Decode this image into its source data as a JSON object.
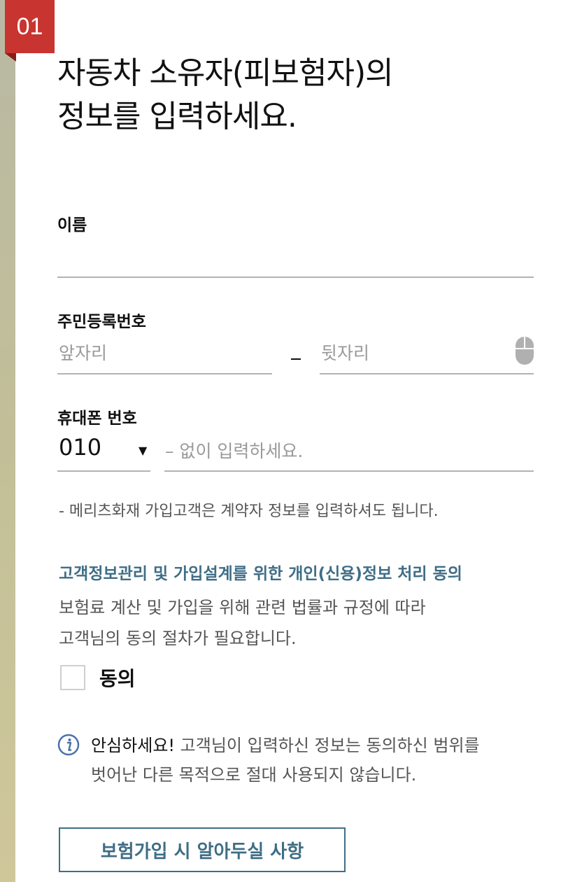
{
  "step": {
    "number": "01"
  },
  "title": {
    "line1": "자동차 소유자(피보험자)의",
    "line2": "정보를 입력하세요."
  },
  "name_field": {
    "label": "이름",
    "value": "",
    "placeholder": ""
  },
  "rrn_field": {
    "label": "주민등록번호",
    "front_placeholder": "앞자리",
    "back_placeholder": "뒷자리",
    "separator": "–",
    "keypad_icon": "mouse-icon"
  },
  "phone_field": {
    "label": "휴대폰 번호",
    "prefix_selected": "010",
    "number_placeholder": "– 없이 입력하세요."
  },
  "note": "- 메리츠화재 가입고객은 계약자 정보를 입력하셔도 됩니다.",
  "consent": {
    "title": "고객정보관리 및 가입설계를 위한 개인(신용)정보 처리 동의",
    "description_line1": "보험료 계산 및 가입을 위해 관련 법률과 규정에 따라",
    "description_line2": "고객님의 동의 절차가 필요합니다.",
    "checkbox_label": "동의",
    "checked": false
  },
  "info": {
    "emphasis": "안심하세요!",
    "text_line1": " 고객님이 입력하신 정보는 동의하신 범위를",
    "text_line2": "벗어난 다른 목적으로 절대 사용되지 않습니다.",
    "icon": "info-icon"
  },
  "notice_button": {
    "label": "보험가입 시 알아두실 사항"
  },
  "colors": {
    "badge_red": "#c8342f",
    "accent_teal": "#3f6e86",
    "strip_olive": "#c2bf98",
    "underline_gray": "#b3b3b3",
    "placeholder_gray": "#9a9a9a"
  }
}
